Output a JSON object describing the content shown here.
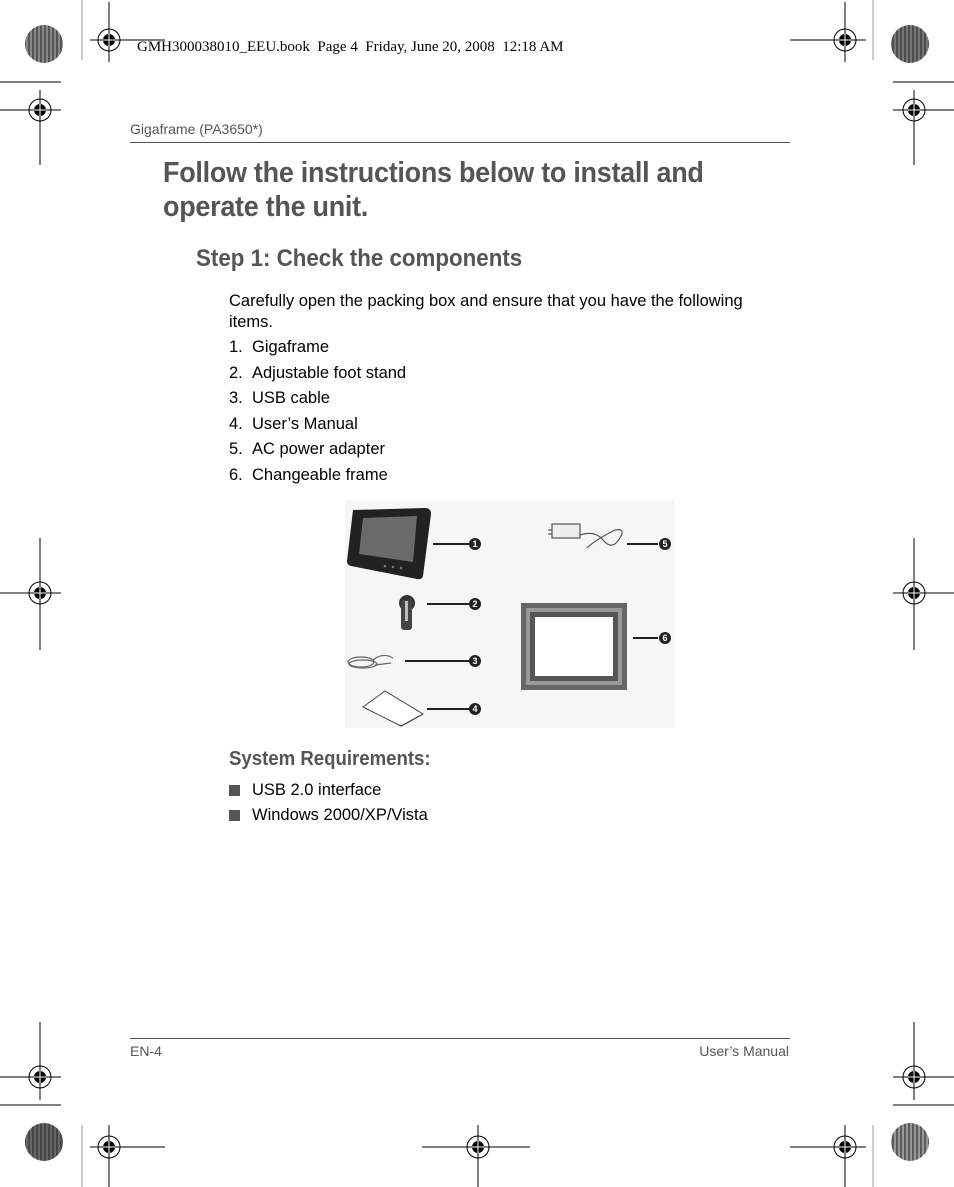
{
  "slug": "GMH300038010_EEU.book  Page 4  Friday, June 20, 2008  12:18 AM",
  "running_head": "Gigaframe (PA3650*)",
  "title": "Follow the instructions below to install and operate the unit.",
  "step": {
    "heading": "Step 1: Check the components",
    "intro": "Carefully open the packing box and ensure that you have the following items.",
    "items": [
      {
        "num": "1.",
        "label": "Gigaframe"
      },
      {
        "num": "2.",
        "label": "Adjustable foot stand"
      },
      {
        "num": "3.",
        "label": "USB cable"
      },
      {
        "num": "4.",
        "label": "User’s Manual"
      },
      {
        "num": "5.",
        "label": "AC power adapter"
      },
      {
        "num": "6.",
        "label": "Changeable frame"
      }
    ]
  },
  "figure": {
    "callouts": [
      "1",
      "2",
      "3",
      "4",
      "5",
      "6"
    ]
  },
  "requirements": {
    "heading": "System Requirements:",
    "items": [
      "USB 2.0 interface",
      "Windows 2000/XP/Vista"
    ]
  },
  "footer": {
    "page": "EN-4",
    "manual": "User’s Manual"
  }
}
